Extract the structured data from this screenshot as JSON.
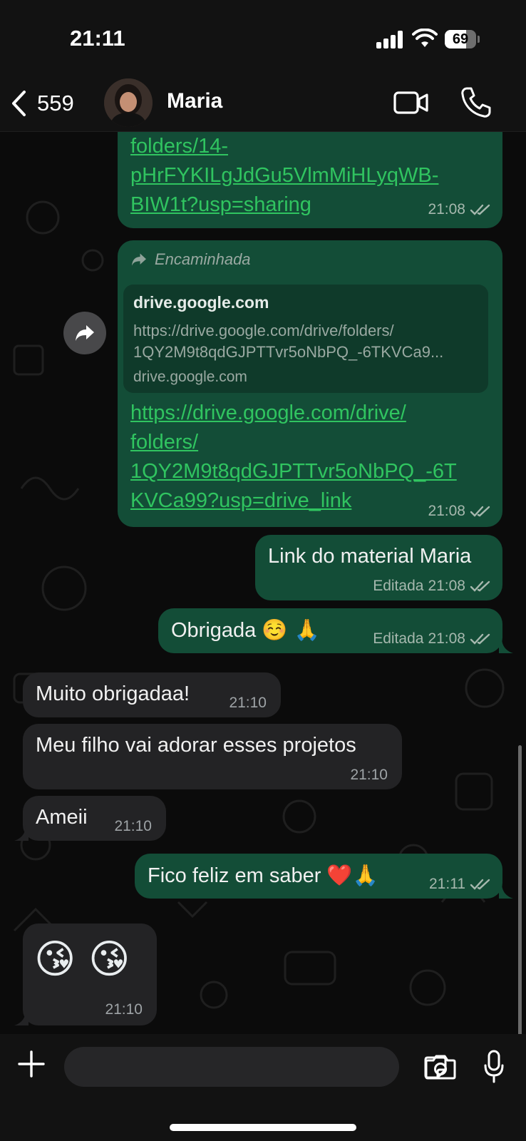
{
  "status_bar": {
    "time": "21:11",
    "battery_percent": 69,
    "battery_label": "69"
  },
  "header": {
    "back_count": "559",
    "contact_name": "Maria"
  },
  "messages": {
    "m1": {
      "link_lines": [
        "folders/14-",
        "pHrFYKILgJdGu5VlmMiHLyqWB-",
        "BIW1t?usp=sharing"
      ],
      "time": "21:08"
    },
    "m2": {
      "forwarded_label": "Encaminhada",
      "preview_title": "drive.google.com",
      "preview_url_1": "https://drive.google.com/drive/folders/",
      "preview_url_2": "1QY2M9t8qdGJPTTvr5oNbPQ_-6TKVCa9...",
      "preview_domain": "drive.google.com",
      "link_lines": [
        "https://drive.google.com/drive/",
        "folders/",
        "1QY2M9t8qdGJPTTvr5oNbPQ_-6T",
        "KVCa99?usp=drive_link"
      ],
      "time": "21:08"
    },
    "m3": {
      "text": "Link do material Maria",
      "edited_label": "Editada",
      "time": "21:08"
    },
    "m4": {
      "text": "Obrigada",
      "emojis": "☺️ 🙏",
      "edited_label": "Editada",
      "time": "21:08"
    },
    "m5": {
      "text": "Muito obrigadaa!",
      "time": "21:10"
    },
    "m6": {
      "text": "Meu filho vai adorar esses projetos",
      "time": "21:10"
    },
    "m7": {
      "text": "Ameii",
      "time": "21:10"
    },
    "m8": {
      "text": "Fico feliz em saber",
      "emojis": "❤️🙏",
      "time": "21:11"
    },
    "m9": {
      "emojis": "😘 😘",
      "time": "21:10"
    }
  },
  "composer": {
    "placeholder": ""
  },
  "colors": {
    "outgoing_bubble": "#134d37",
    "incoming_bubble": "#232325",
    "link": "#30c460",
    "background": "#0b0b0b"
  },
  "icons": [
    "chevron-left-icon",
    "video-icon",
    "phone-icon",
    "forward-icon",
    "double-check-icon",
    "plus-icon",
    "sticker-icon",
    "camera-icon",
    "microphone-icon"
  ]
}
